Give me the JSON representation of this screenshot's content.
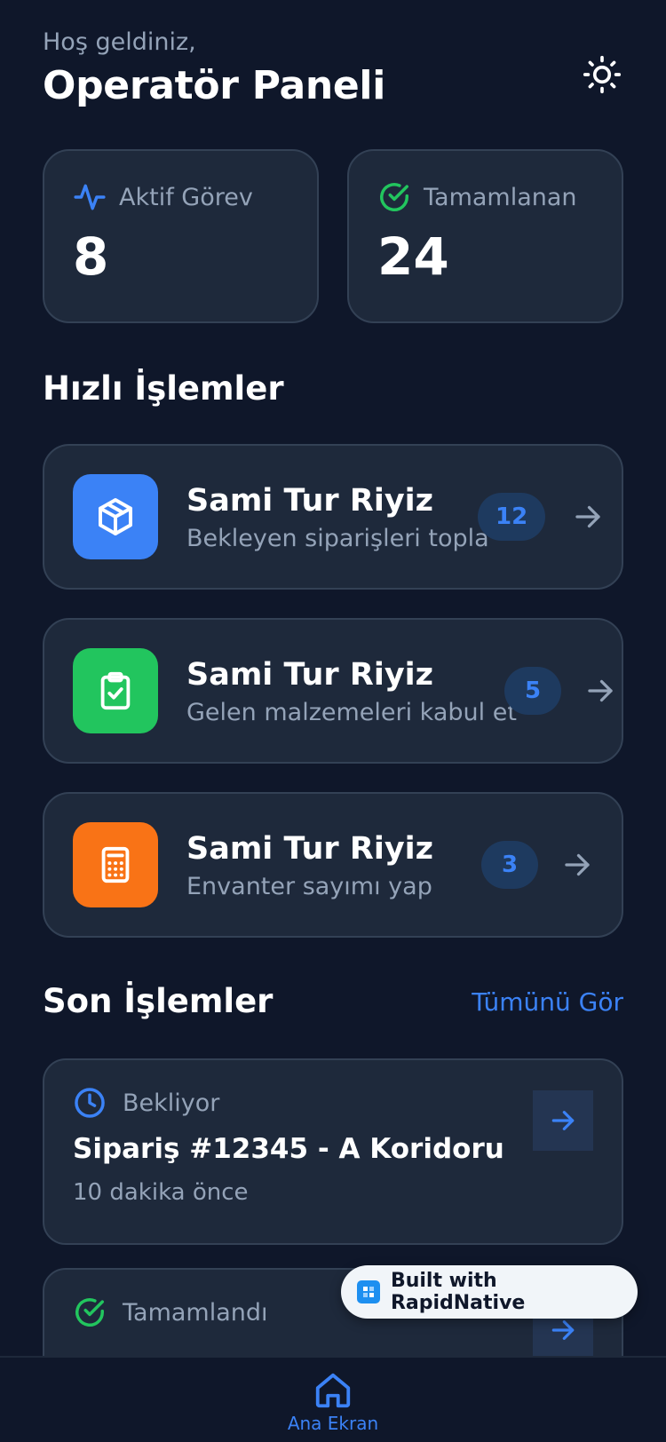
{
  "header": {
    "greeting": "Hoş geldiniz,",
    "title": "Operatör Paneli"
  },
  "stats": [
    {
      "label": "Aktif Görev",
      "value": "8",
      "icon": "activity-icon",
      "color": "#3b82f6"
    },
    {
      "label": "Tamamlanan",
      "value": "24",
      "icon": "check-circle-icon",
      "color": "#22c55e"
    }
  ],
  "quick_actions": {
    "title": "Hızlı İşlemler",
    "items": [
      {
        "title": "Sami Tur Riyiz",
        "subtitle": "Bekleyen siparişleri topla",
        "badge": "12",
        "icon": "package-icon",
        "color": "#3b82f6"
      },
      {
        "title": "Sami Tur Riyiz",
        "subtitle": "Gelen malzemeleri kabul et",
        "badge": "5",
        "icon": "clipboard-check-icon",
        "color": "#22c55e"
      },
      {
        "title": "Sami Tur Riyiz",
        "subtitle": "Envanter sayımı yap",
        "badge": "3",
        "icon": "calculator-icon",
        "color": "#f97316"
      }
    ]
  },
  "recent": {
    "title": "Son İşlemler",
    "see_all": "Tümünü Gör",
    "items": [
      {
        "status": "Bekliyor",
        "title": "Sipariş #12345 - A Koridoru",
        "time": "10 dakika önce",
        "icon": "clock-icon",
        "color": "#3b82f6"
      },
      {
        "status": "Tamamlandı",
        "icon": "check-circle-icon",
        "color": "#22c55e"
      }
    ]
  },
  "tabbar": {
    "home_label": "Ana Ekran"
  },
  "badge": {
    "label": "Built with RapidNative"
  }
}
